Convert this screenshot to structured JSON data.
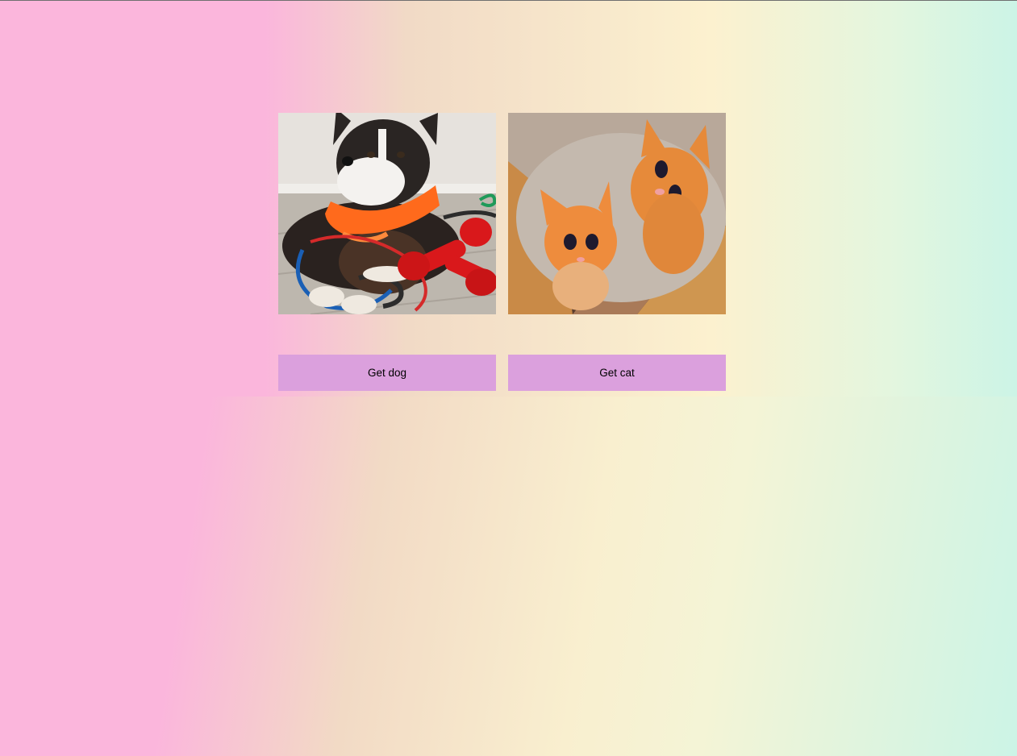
{
  "theme": {
    "gradient_left": "#fbb6dc",
    "gradient_middle": "#fcf1cf",
    "gradient_right": "#ccf4e6",
    "button_bg": "#dba0dd"
  },
  "cards": [
    {
      "photo_icon": "dog-photo",
      "button_label": "Get dog"
    },
    {
      "photo_icon": "cat-photo",
      "button_label": "Get cat"
    }
  ]
}
